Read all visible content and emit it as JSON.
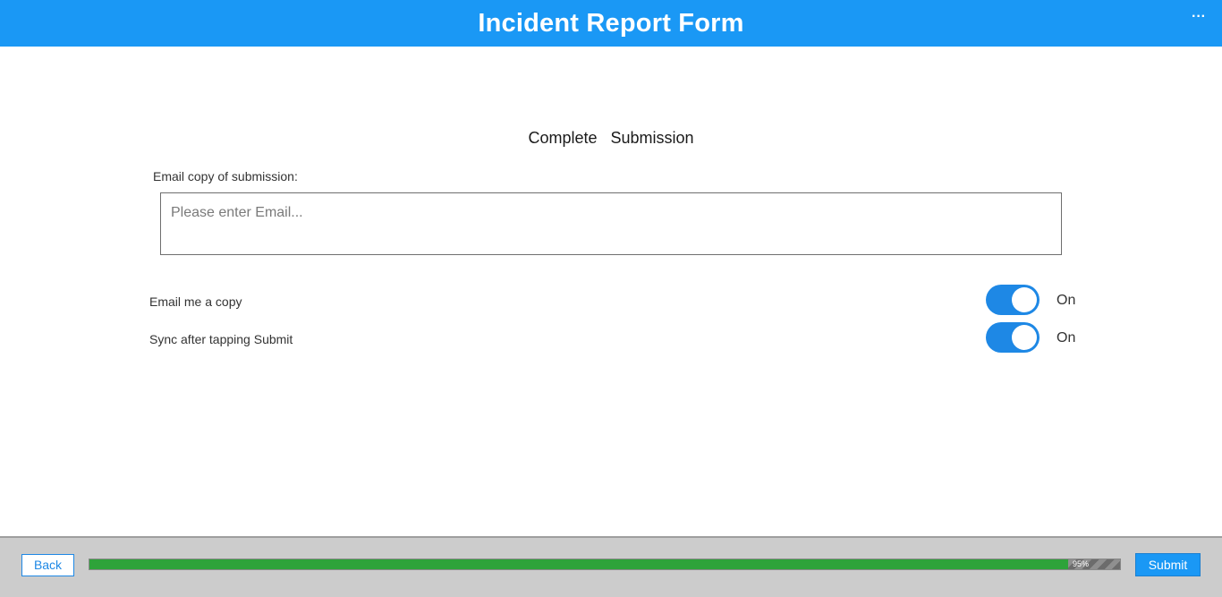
{
  "header": {
    "title": "Incident Report Form",
    "more_icon": "more-horizontal-icon",
    "more_label": "···",
    "background_color": "#1a98f5"
  },
  "main": {
    "section_title": "Complete Submission",
    "email": {
      "label": "Email copy of submission:",
      "value": "",
      "placeholder": "Please enter Email..."
    },
    "toggles": [
      {
        "label": "Email me a copy",
        "state": "On",
        "checked": true
      },
      {
        "label": "Sync after tapping Submit",
        "state": "On",
        "checked": true
      }
    ],
    "toggle_color": "#1e88e5"
  },
  "footer": {
    "back_label": "Back",
    "submit_label": "Submit",
    "progress": {
      "percent": 95,
      "label": "95%",
      "fill_color": "#2ea33a"
    }
  }
}
